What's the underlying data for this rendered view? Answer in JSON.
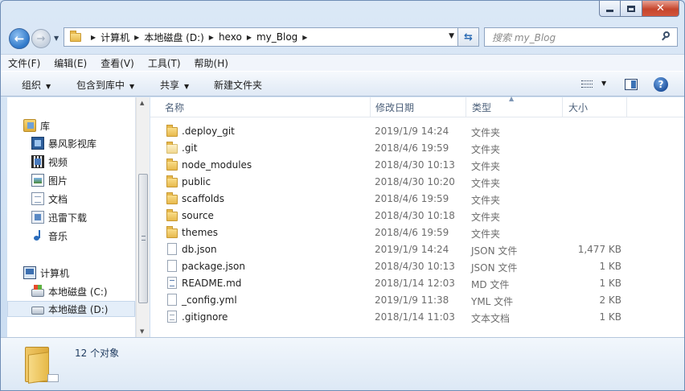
{
  "window": {
    "caption_icons": [
      "minimize-icon",
      "maximize-icon",
      "close-icon"
    ]
  },
  "address": {
    "breadcrumbs": [
      "计算机",
      "本地磁盘 (D:)",
      "hexo",
      "my_Blog"
    ]
  },
  "search": {
    "placeholder": "搜索 my_Blog"
  },
  "menubar": [
    "文件(F)",
    "编辑(E)",
    "查看(V)",
    "工具(T)",
    "帮助(H)"
  ],
  "toolbar": {
    "organize": "组织",
    "include_in_library": "包含到库中",
    "share": "共享",
    "new_folder": "新建文件夹"
  },
  "navpane": {
    "libraries_label": "库",
    "libraries": [
      "暴风影视库",
      "视频",
      "图片",
      "文档",
      "迅雷下载",
      "音乐"
    ],
    "computer_label": "计算机",
    "drives": [
      "本地磁盘 (C:)",
      "本地磁盘 (D:)"
    ],
    "selected": "本地磁盘 (D:)"
  },
  "columns": {
    "name": "名称",
    "modified": "修改日期",
    "type": "类型",
    "size": "大小"
  },
  "files": [
    {
      "name": ".deploy_git",
      "modified": "2019/1/9 14:24",
      "type": "文件夹",
      "size": "",
      "icon": "folder"
    },
    {
      "name": ".git",
      "modified": "2018/4/6 19:59",
      "type": "文件夹",
      "size": "",
      "icon": "folder-hidden"
    },
    {
      "name": "node_modules",
      "modified": "2018/4/30 10:13",
      "type": "文件夹",
      "size": "",
      "icon": "folder"
    },
    {
      "name": "public",
      "modified": "2018/4/30 10:20",
      "type": "文件夹",
      "size": "",
      "icon": "folder"
    },
    {
      "name": "scaffolds",
      "modified": "2018/4/6 19:59",
      "type": "文件夹",
      "size": "",
      "icon": "folder"
    },
    {
      "name": "source",
      "modified": "2018/4/30 10:18",
      "type": "文件夹",
      "size": "",
      "icon": "folder"
    },
    {
      "name": "themes",
      "modified": "2018/4/6 19:59",
      "type": "文件夹",
      "size": "",
      "icon": "folder"
    },
    {
      "name": "db.json",
      "modified": "2019/1/9 14:24",
      "type": "JSON 文件",
      "size": "1,477 KB",
      "icon": "file"
    },
    {
      "name": "package.json",
      "modified": "2018/4/30 10:13",
      "type": "JSON 文件",
      "size": "1 KB",
      "icon": "file"
    },
    {
      "name": "README.md",
      "modified": "2018/1/14 12:03",
      "type": "MD 文件",
      "size": "1 KB",
      "icon": "md-file"
    },
    {
      "name": "_config.yml",
      "modified": "2019/1/9 11:38",
      "type": "YML 文件",
      "size": "2 KB",
      "icon": "file"
    },
    {
      "name": ".gitignore",
      "modified": "2018/1/14 11:03",
      "type": "文本文档",
      "size": "1 KB",
      "icon": "text-file"
    }
  ],
  "status": {
    "item_count": "12 个对象"
  }
}
